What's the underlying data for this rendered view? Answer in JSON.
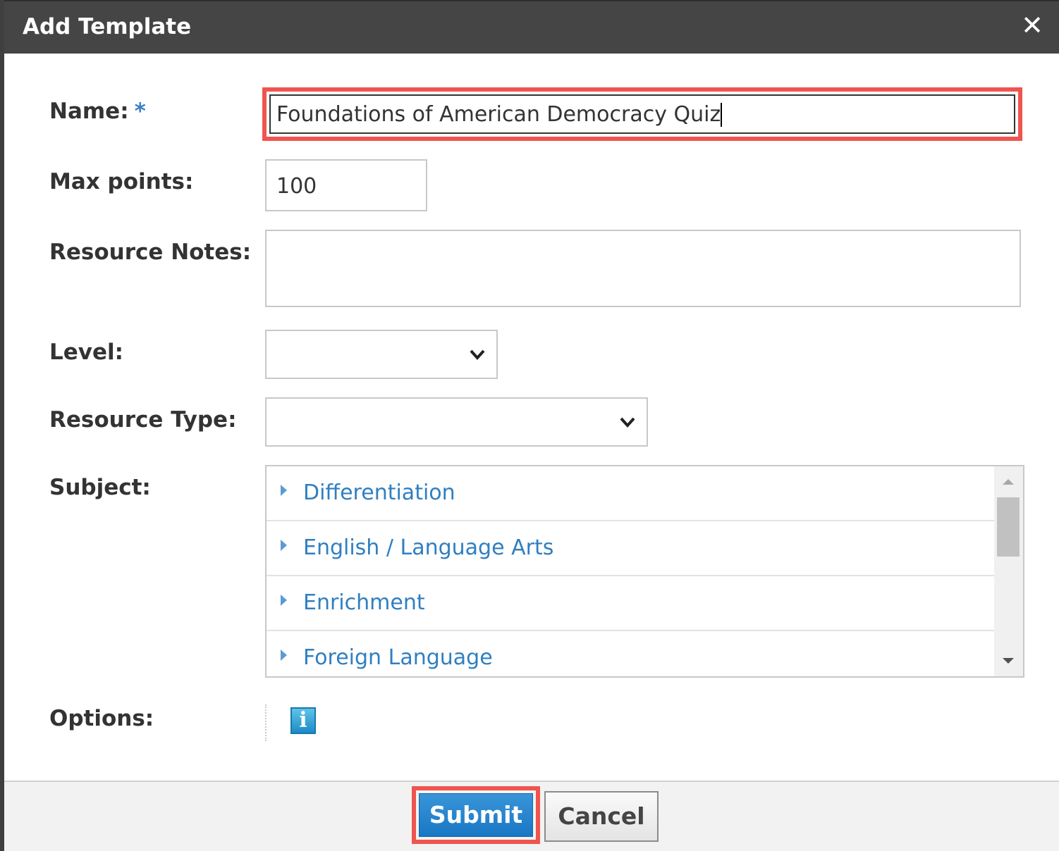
{
  "dialog": {
    "title": "Add Template",
    "close_icon": "close-icon"
  },
  "form": {
    "name_label": "Name:",
    "name_required_marker": "*",
    "name_value": "Foundations of American Democracy Quiz",
    "max_points_label": "Max points:",
    "max_points_value": "100",
    "resource_notes_label": "Resource Notes:",
    "resource_notes_value": "",
    "level_label": "Level:",
    "level_value": "",
    "resource_type_label": "Resource Type:",
    "resource_type_value": "",
    "subject_label": "Subject:",
    "subjects": [
      {
        "label": "Differentiation"
      },
      {
        "label": "English / Language Arts"
      },
      {
        "label": "Enrichment"
      },
      {
        "label": "Foreign Language"
      }
    ],
    "options_label": "Options:",
    "info_icon_glyph": "i"
  },
  "footer": {
    "submit_label": "Submit",
    "cancel_label": "Cancel"
  },
  "colors": {
    "title_bar": "#454545",
    "highlight": "#f0544f",
    "link": "#2f7fc1",
    "submit": "#1f80c9"
  }
}
